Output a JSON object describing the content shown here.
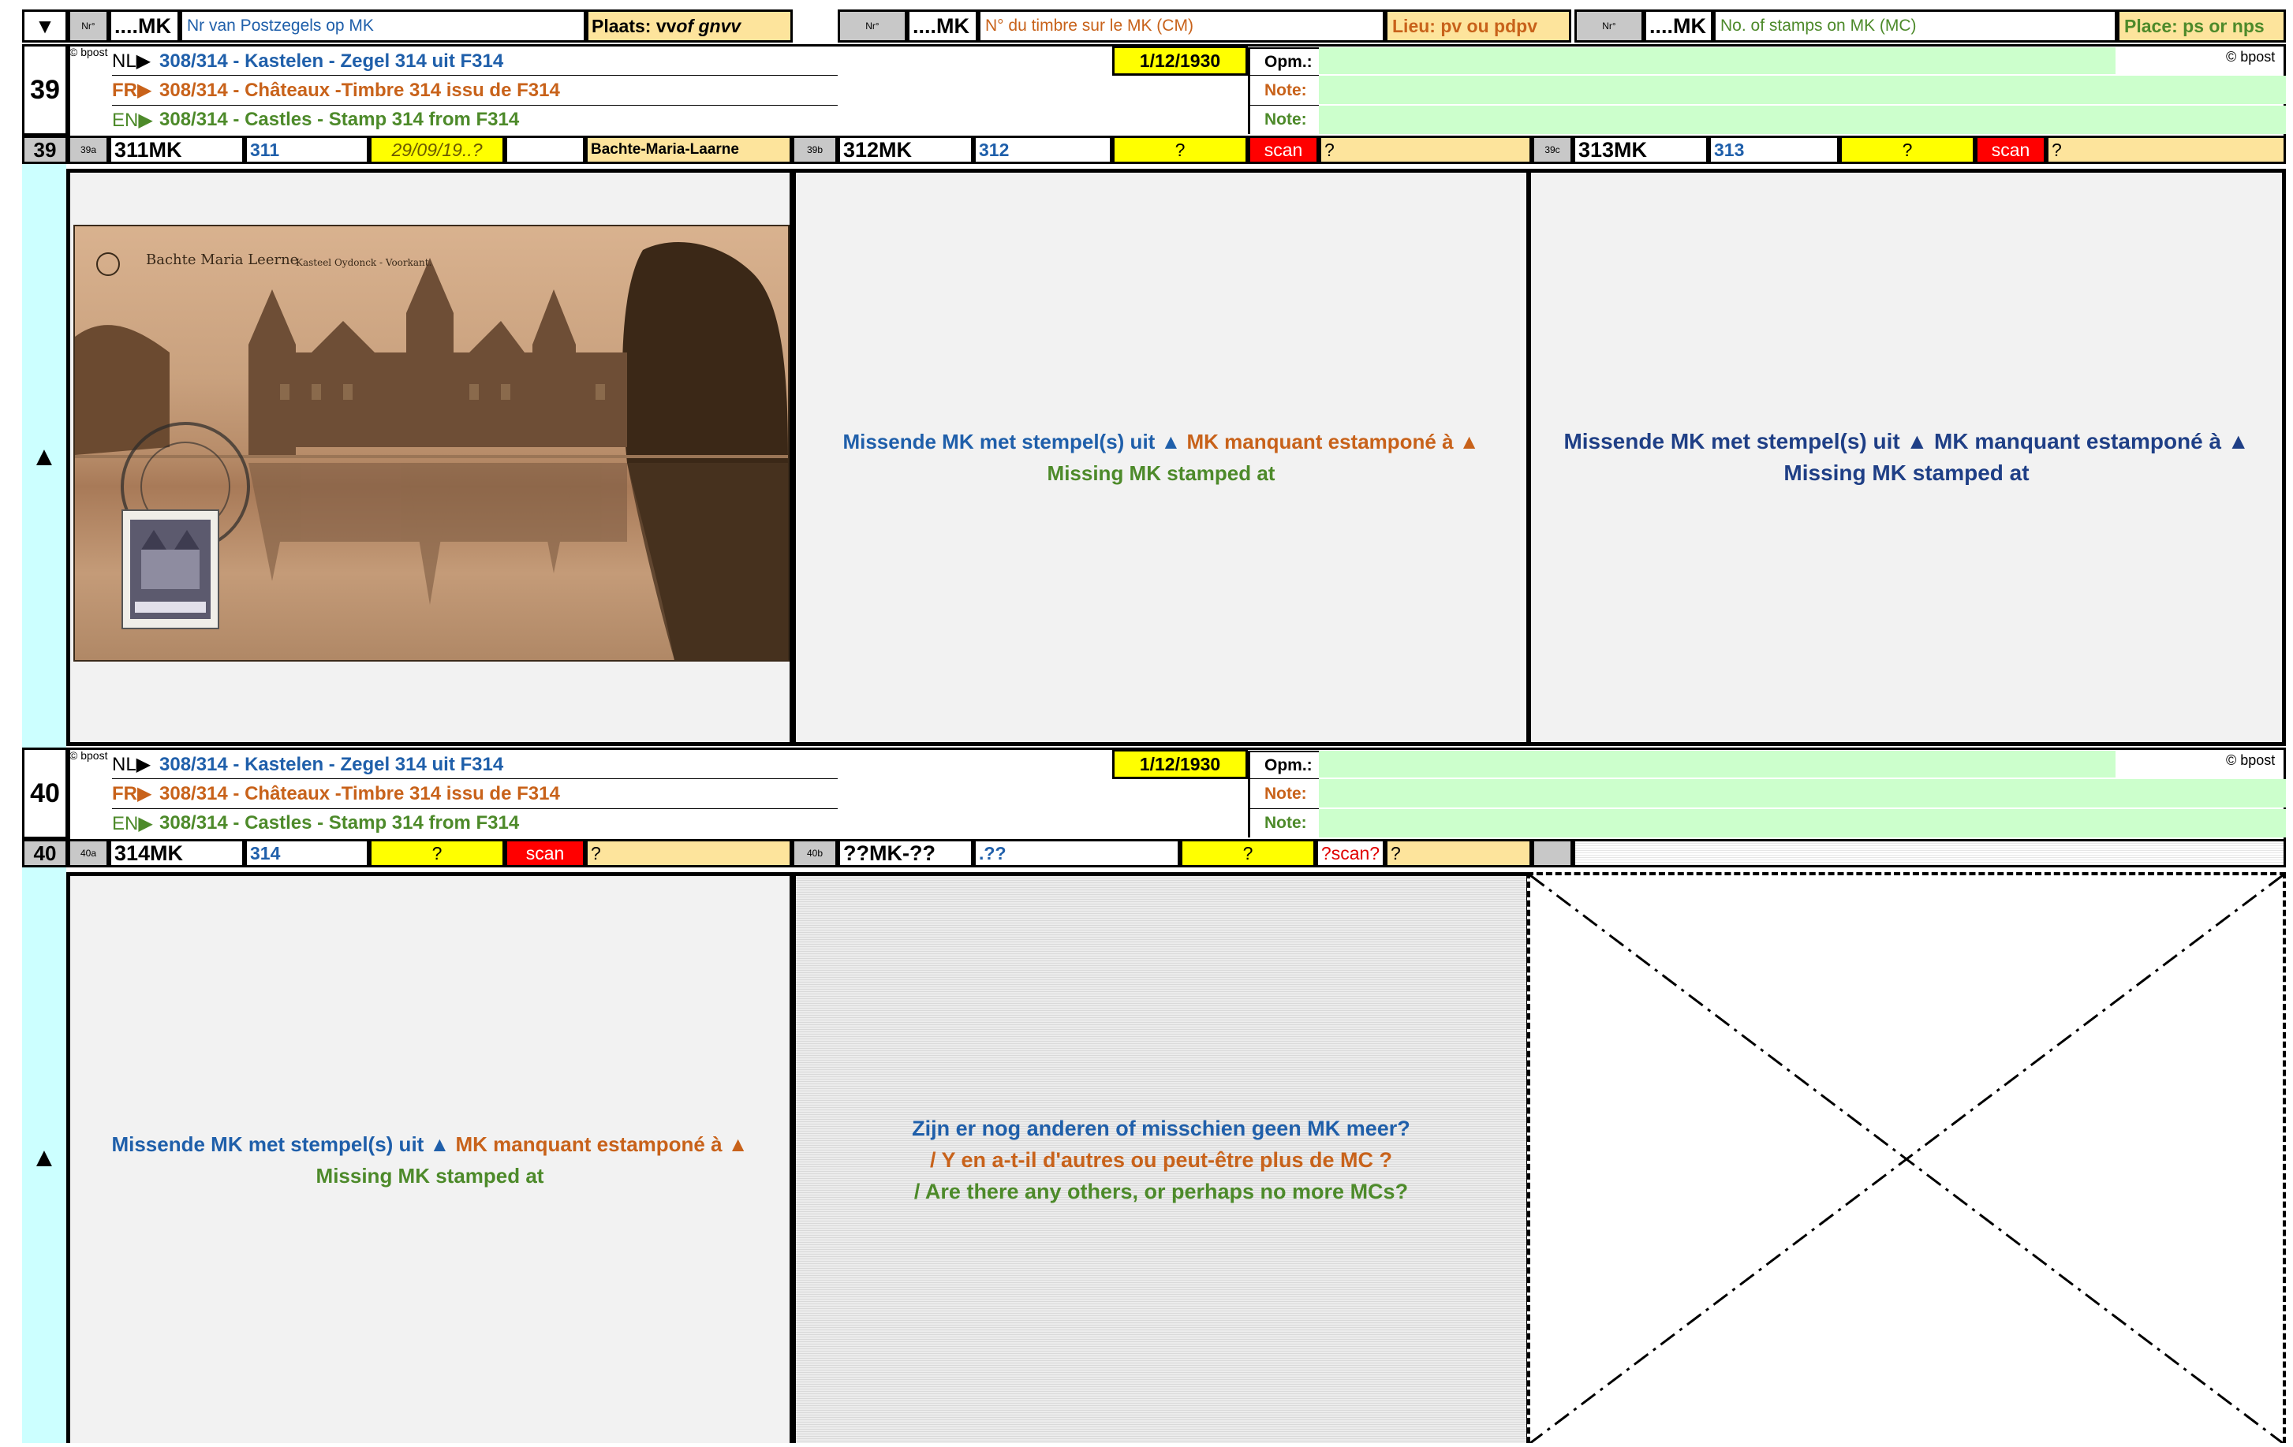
{
  "header": {
    "arrow": "▼",
    "nl": {
      "nr": "Nr°",
      "mk": "....MK",
      "title": "Nr van Postzegels op MK",
      "place": "Plaats: vv of gnvv"
    },
    "fr": {
      "nr": "Nr°",
      "mk": "....MK",
      "title": "N° du timbre sur le MK (CM)",
      "place": "Lieu: pv ou pdpv"
    },
    "en": {
      "nr": "Nr°",
      "mk": "....MK",
      "title": "No. of stamps on MK (MC)",
      "place": "Place: ps or nps"
    }
  },
  "blocks": [
    {
      "number": "39",
      "bpost": "© bpost",
      "bpost_right": "© bpost",
      "date": "1/12/1930",
      "opm_label": "Opm.:",
      "note_fr": "Note:",
      "note_en": "Note:",
      "lines": [
        {
          "code": "NL▶",
          "text": "308/314 - Kastelen - Zegel 314 uit F314"
        },
        {
          "code": "FR▶",
          "text": "308/314 - Châteaux -Timbre 314 issu de F314"
        },
        {
          "code": "EN▶",
          "text": "308/314 - Castles - Stamp 314 from F314"
        }
      ],
      "row_num": "39",
      "items": [
        {
          "sub": "39a",
          "mk": "311MK",
          "stamp": "311",
          "date": "29/09/19..?",
          "place": "Bachte-Maria-Laarne"
        },
        {
          "sub": "39b",
          "mk": "312MK",
          "stamp": "312",
          "date": "?",
          "scan": "scan",
          "q": "?"
        },
        {
          "sub": "39c",
          "mk": "313MK",
          "stamp": "313",
          "date": "?",
          "scan": "scan",
          "q": "?"
        }
      ],
      "side_arrow": "▲",
      "postcard": {
        "caption": "Bachte Maria Leerne",
        "subcaption": "Kasteel Oydonck - Voorkant."
      },
      "missing": [
        {
          "nl": "Missende MK met stempel(s) uit ▲",
          "fr": "MK manquant estamponé à ▲",
          "en": "Missing MK stamped at"
        },
        {
          "nl": "Missende MK met stempel(s) uit ▲",
          "fr": "MK manquant estamponé à ▲",
          "en": "Missing MK stamped at"
        }
      ]
    },
    {
      "number": "40",
      "bpost": "© bpost",
      "bpost_right": "© bpost",
      "date": "1/12/1930",
      "opm_label": "Opm.:",
      "note_fr": "Note:",
      "note_en": "Note:",
      "lines": [
        {
          "code": "NL▶",
          "text": "308/314 - Kastelen - Zegel 314 uit F314"
        },
        {
          "code": "FR▶",
          "text": "308/314 - Châteaux -Timbre 314 issu de F314"
        },
        {
          "code": "EN▶",
          "text": "308/314 - Castles - Stamp 314 from F314"
        }
      ],
      "row_num": "40",
      "items": [
        {
          "sub": "40a",
          "mk": "314MK",
          "stamp": "314",
          "date": "?",
          "scan": "scan",
          "q": "?"
        },
        {
          "sub": "40b",
          "mk": "??MK-??",
          "stamp": ".??",
          "date": "?",
          "scan": "?scan?",
          "q": "?"
        }
      ],
      "side_arrow": "▲",
      "missing": [
        {
          "nl": "Missende MK met stempel(s) uit ▲",
          "fr": "MK manquant estamponé à ▲",
          "en": "Missing MK stamped at"
        }
      ],
      "question": {
        "nl": "Zijn er nog anderen of misschien geen MK meer?",
        "fr": "/ Y en a-t-il d'autres ou peut-être plus de MC ?",
        "en": "/ Are there any others, or perhaps no more MCs?"
      }
    }
  ]
}
